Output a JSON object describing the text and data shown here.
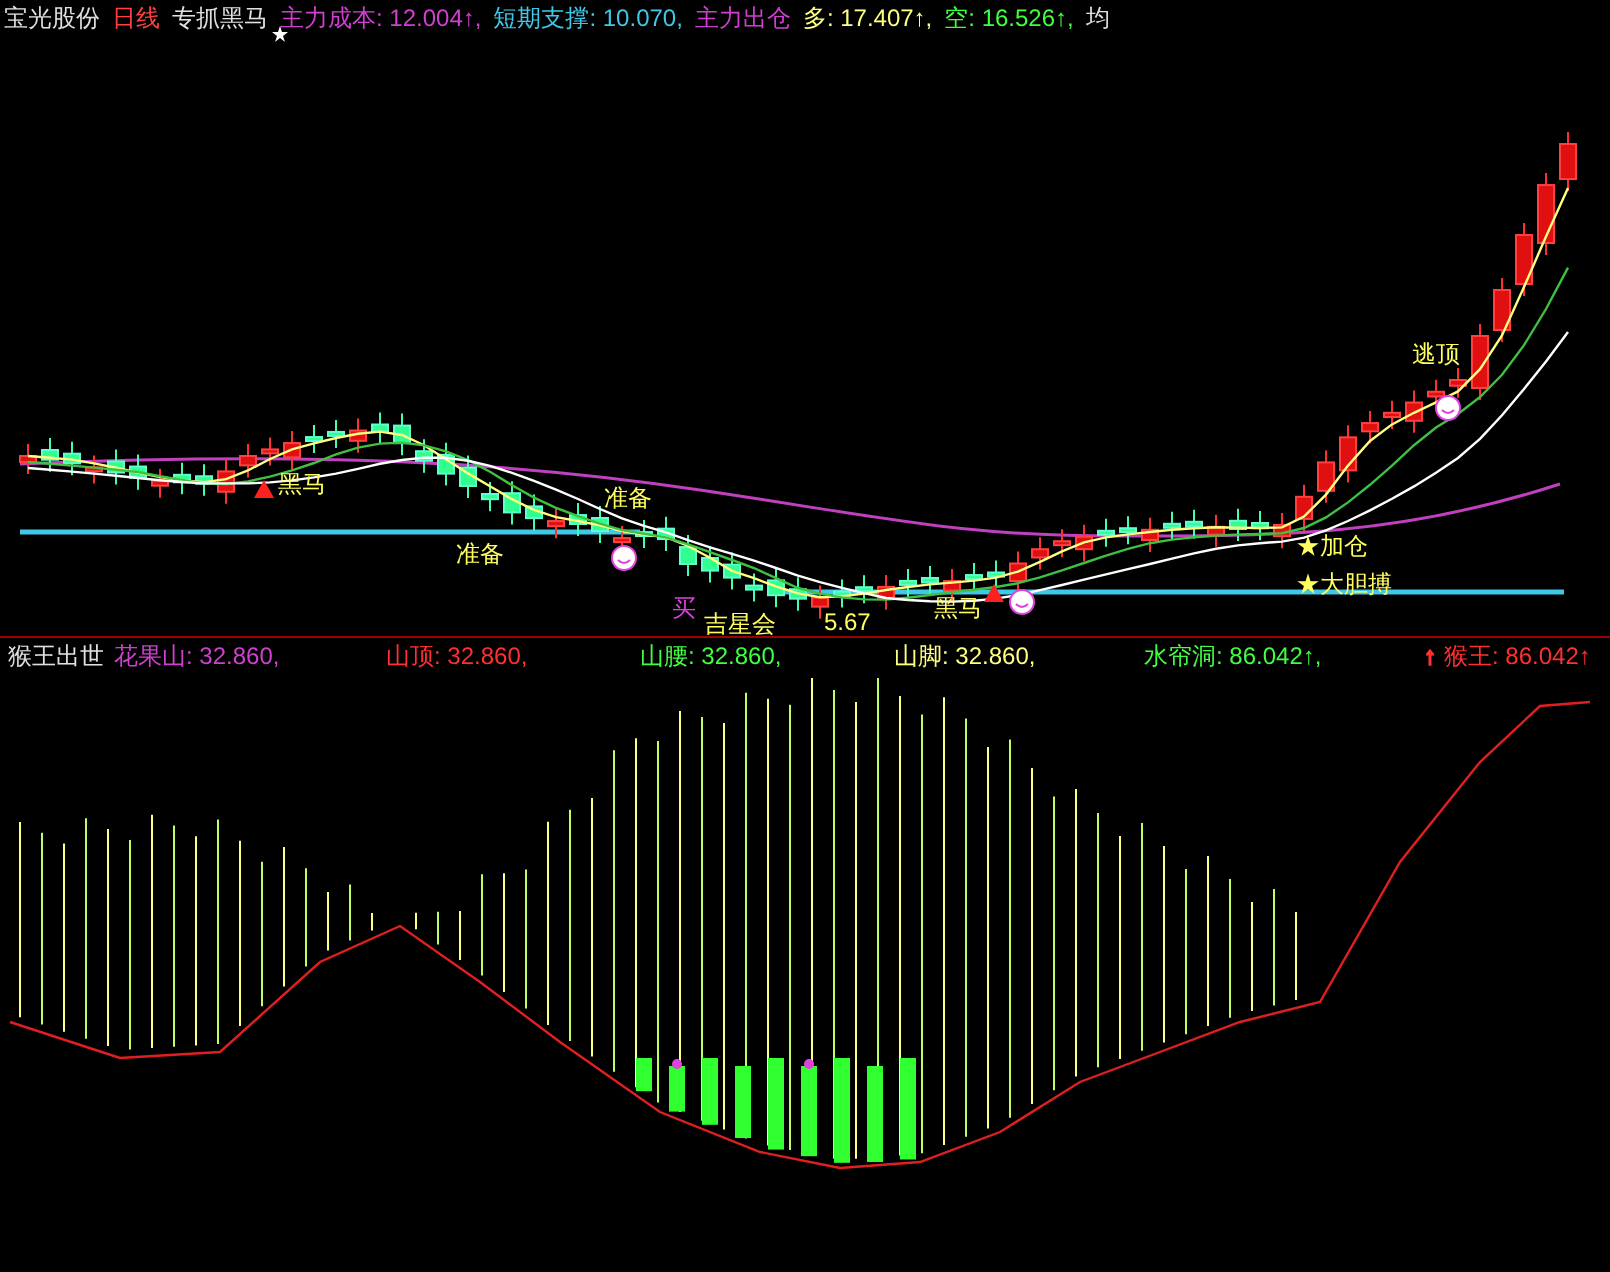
{
  "top_panel": {
    "header": [
      {
        "text": "宝光股份",
        "color": "#e0e0e0"
      },
      {
        "text": "日线",
        "color": "#ff4040"
      },
      {
        "text": "专抓黑马",
        "color": "#e0e0e0"
      },
      {
        "text": "主力成本: 12.004↑,",
        "color": "#d040d0"
      },
      {
        "text": "短期支撑: 10.070,",
        "color": "#40c8e8"
      },
      {
        "text": "主力出仓",
        "color": "#d040d0"
      },
      {
        "text": "多: 17.407↑,",
        "color": "#ffff80"
      },
      {
        "text": "空: 16.526↑,",
        "color": "#40ff40"
      },
      {
        "text": "均",
        "color": "#e0e0e0"
      }
    ],
    "annotations": [
      {
        "text": "黑马",
        "color": "#ffff60"
      },
      {
        "text": "准备",
        "color": "#ffff60"
      },
      {
        "text": "准备",
        "color": "#ffff60"
      },
      {
        "text": "买",
        "color": "#e040e0"
      },
      {
        "text": "吉星会",
        "color": "#ffff60"
      },
      {
        "text": "5.67",
        "color": "#ffff60"
      },
      {
        "text": "黑马",
        "color": "#ffff60"
      },
      {
        "text": "逃顶",
        "color": "#ffff60"
      },
      {
        "text": "★加仓",
        "color": "#ffff60"
      },
      {
        "text": "★大胆搏",
        "color": "#ffff60"
      }
    ]
  },
  "bottom_panel": {
    "header": [
      {
        "text": "猴王出世",
        "color": "#e0e0e0"
      },
      {
        "text": "花果山: 32.860,",
        "color": "#d040d0"
      },
      {
        "text": "山顶: 32.860,",
        "color": "#ff3030"
      },
      {
        "text": "山腰: 32.860,",
        "color": "#40ff40"
      },
      {
        "text": "山脚: 32.860,",
        "color": "#ffff80"
      },
      {
        "text": "水帘洞: 86.042↑,",
        "color": "#40ff40"
      },
      {
        "text": "↑",
        "color": "#ff3030"
      },
      {
        "text": "猴王: 86.042↑",
        "color": "#ff3030"
      }
    ]
  }
}
